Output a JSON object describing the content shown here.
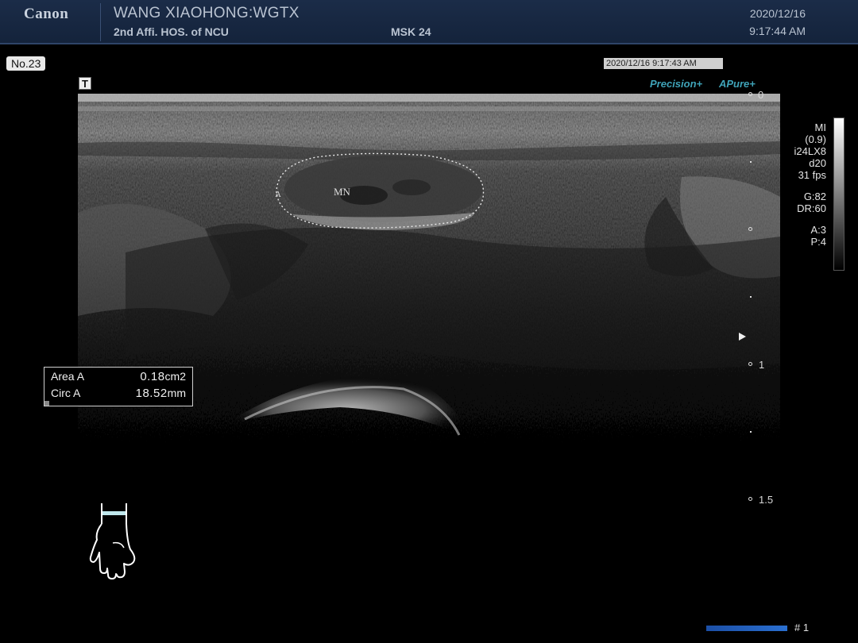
{
  "header": {
    "brand": "Canon",
    "patient": "WANG XIAOHONG:WGTX",
    "hospital": "2nd Affi. HOS. of NCU",
    "preset": "MSK 24",
    "date": "2020/12/16",
    "time": "9:17:44 AM"
  },
  "image_number": "No.23",
  "orientation_marker": "T",
  "timestamp_overlay": "2020/12/16 9:17:43 AM",
  "modes": {
    "precision": "Precision+",
    "apure": "APure+"
  },
  "parameters": {
    "mi": "MI",
    "mi_value": "(0.9)",
    "probe": "i24LX8",
    "depth": "d20",
    "frame_rate": "31 fps",
    "gain": "G:82",
    "dynamic_range": "DR:60",
    "a": "A:3",
    "p": "P:4"
  },
  "depth_scale": {
    "labels": [
      "0",
      "1",
      "1.5"
    ]
  },
  "annotation": {
    "label": "MN",
    "marker": "A"
  },
  "measurements": [
    {
      "label": "Area A",
      "value": "0.18",
      "unit": "cm2"
    },
    {
      "label": "Circ A",
      "value": "18.52",
      "unit": "mm"
    }
  ],
  "cine": {
    "label": "# 1"
  },
  "colors": {
    "header_bg": "#1b2c48",
    "accent_teal": "#3fa3b8",
    "cine_blue": "#2a6fd0"
  },
  "icons": {
    "body_marker": "hand-wrist-icon",
    "focus": "focus-triangle-icon"
  }
}
